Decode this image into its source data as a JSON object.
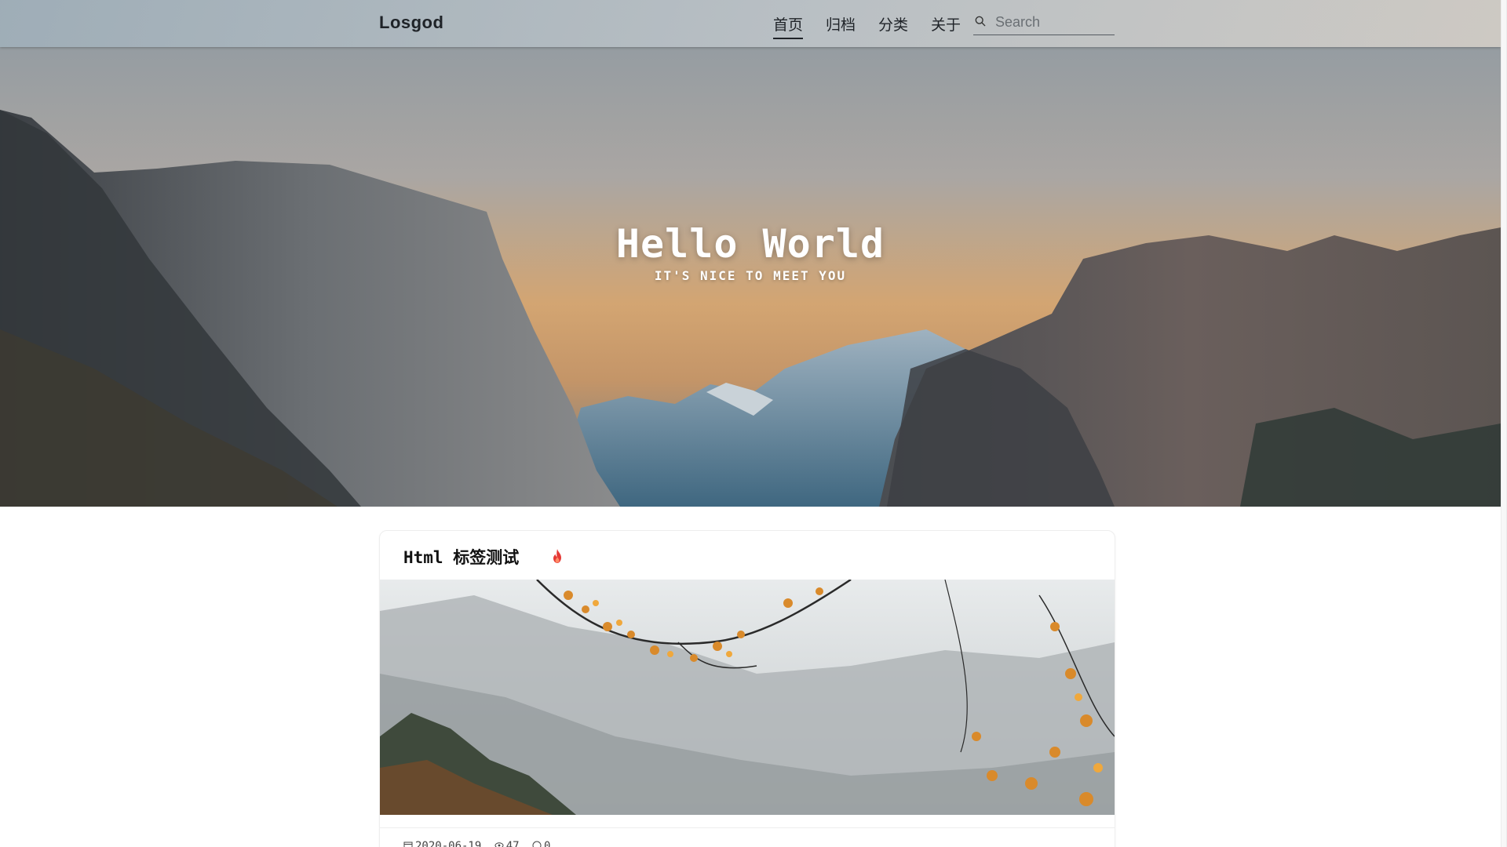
{
  "navbar": {
    "brand": "Losgod",
    "items": [
      {
        "label": "首页",
        "active": true
      },
      {
        "label": "归档",
        "active": false
      },
      {
        "label": "分类",
        "active": false
      },
      {
        "label": "关于",
        "active": false
      }
    ],
    "search": {
      "placeholder": "Search",
      "value": "",
      "icon": "search-icon"
    }
  },
  "hero": {
    "title": "Hello World",
    "subtitle": "IT'S NICE TO MEET YOU"
  },
  "posts": [
    {
      "title": "Html 标签测试",
      "badge_icon": "flame-icon",
      "date": "2020-06-19",
      "views": "47",
      "comments": "0"
    }
  ],
  "colors": {
    "text": "#1f2328",
    "hot": "#e53935",
    "card_border": "#eeeeee"
  }
}
